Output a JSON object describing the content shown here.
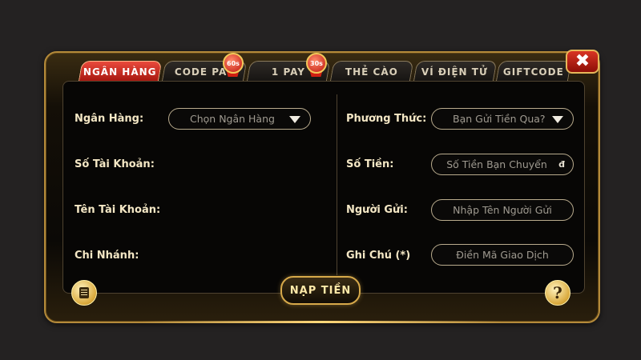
{
  "tabs": [
    {
      "label": "NGÂN HÀNG",
      "active": true
    },
    {
      "label": "CODE PAY",
      "active": false
    },
    {
      "label": "1 PAY",
      "active": false
    },
    {
      "label": "THẺ CÀO",
      "active": false
    },
    {
      "label": "VÍ ĐIỆN TỬ",
      "active": false
    },
    {
      "label": "GIFTCODE",
      "active": false
    }
  ],
  "badges": {
    "code_pay": "60s",
    "one_pay": "30s"
  },
  "close_icon": "close-icon",
  "left_form": {
    "bank_label": "Ngân Hàng:",
    "bank_select_value": "Chọn Ngân Hàng",
    "account_number_label": "Số Tài Khoản:",
    "account_name_label": "Tên Tài Khoản:",
    "branch_label": "Chi Nhánh:"
  },
  "right_form": {
    "method_label": "Phương Thức:",
    "method_select_value": "Bạn Gửi Tiền Qua?",
    "amount_label": "Số Tiền:",
    "amount_placeholder": "Số Tiền Bạn Chuyển",
    "currency_symbol": "đ",
    "sender_label": "Người Gửi:",
    "sender_placeholder": "Nhập Tên Người Gửi",
    "note_label": "Ghi Chú (*)",
    "note_placeholder": "Điền Mã Giao Dịch"
  },
  "actions": {
    "deposit_label": "NẠP TIỀN",
    "help_glyph": "?",
    "notes_icon": "notes-icon",
    "help_icon": "help-icon"
  },
  "colors": {
    "accent_gold": "#d7a94a",
    "active_tab": "#c8241a",
    "background": "#242222"
  }
}
